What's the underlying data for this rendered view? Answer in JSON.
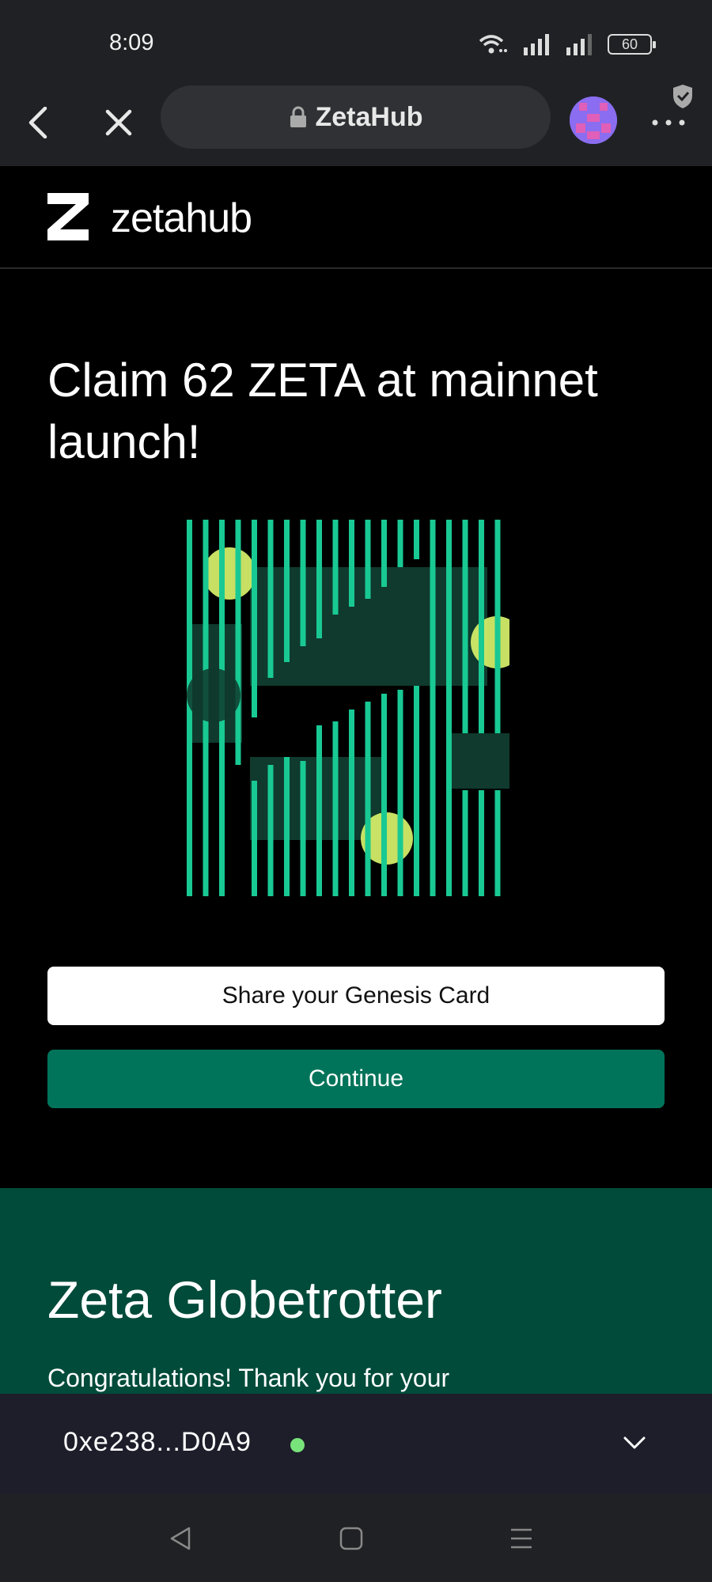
{
  "status_bar": {
    "time": "8:09",
    "battery": "60",
    "icons": [
      "wifi-icon",
      "signal-icon",
      "signal-icon",
      "battery-icon"
    ]
  },
  "browser": {
    "url_title": "ZetaHub",
    "icons": [
      "back-icon",
      "close-icon",
      "lock-icon",
      "avatar",
      "shield-icon",
      "more-icon"
    ]
  },
  "site": {
    "logo_text": "zetahub"
  },
  "hero": {
    "title": "Claim 62 ZETA at mainnet launch!",
    "share_button": "Share your Genesis Card",
    "continue_button": "Continue"
  },
  "card_colors": {
    "bar": "#19c993",
    "bar_dim": "#0f3a2d",
    "dot": "#d8f26a"
  },
  "globetrotter": {
    "title": "Zeta Globetrotter",
    "text": "Congratulations! Thank you for your"
  },
  "wallet": {
    "address": "0xe238...D0A9",
    "status_color": "#78e37a"
  },
  "system_nav": {
    "icons": [
      "back-triangle-icon",
      "home-square-icon",
      "menu-lines-icon"
    ]
  }
}
